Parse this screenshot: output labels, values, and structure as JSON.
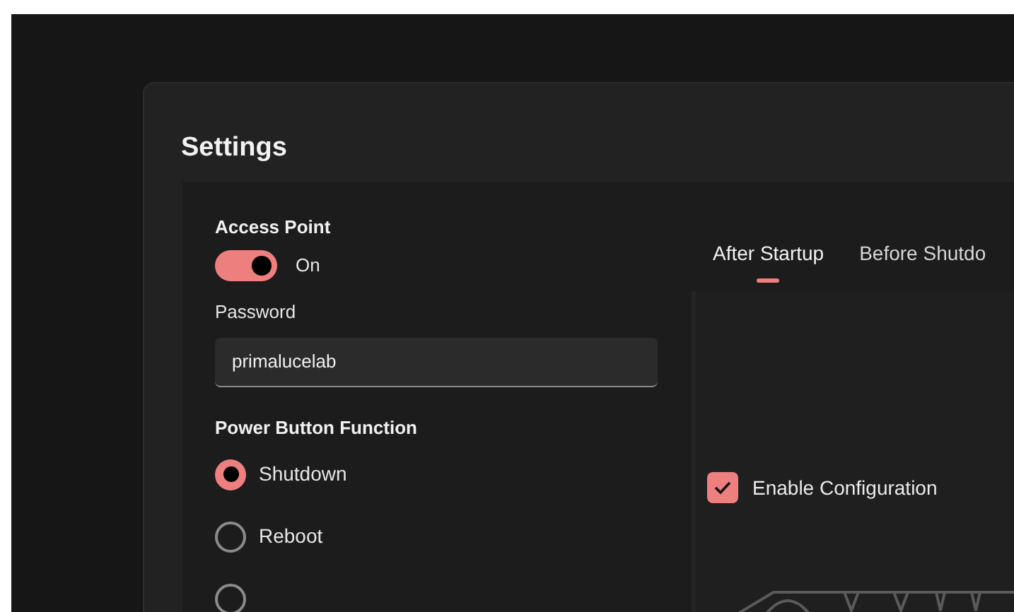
{
  "window": {
    "title": "Settings"
  },
  "access_point": {
    "heading": "Access Point",
    "toggle": {
      "on": true,
      "label": "On"
    },
    "password": {
      "label": "Password",
      "value": "primalucelab"
    }
  },
  "power_button": {
    "heading": "Power Button Function",
    "options": [
      {
        "label": "Shutdown",
        "selected": true
      },
      {
        "label": "Reboot",
        "selected": false
      },
      {
        "selected": false
      }
    ]
  },
  "tabs": [
    {
      "label": "After Startup",
      "selected": true
    },
    {
      "label": "Before Shutdo",
      "selected": false
    }
  ],
  "enable_configuration": {
    "label": "Enable Configuration",
    "checked": true
  }
}
